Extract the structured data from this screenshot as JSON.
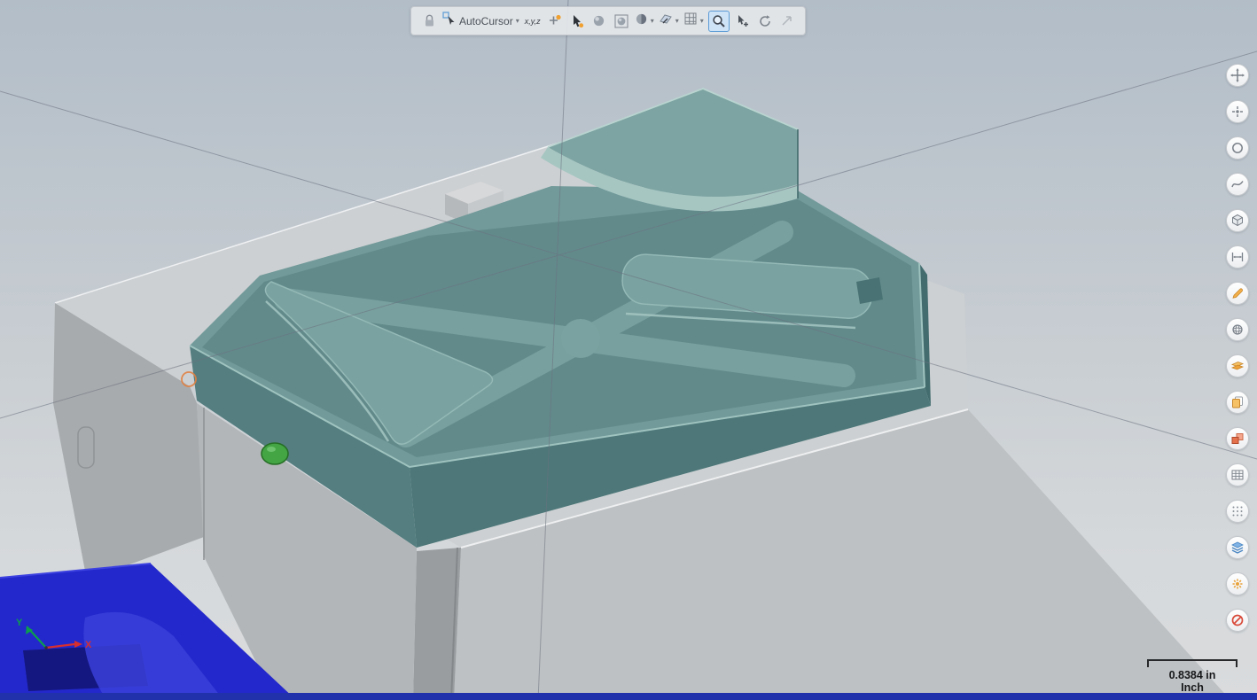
{
  "toolbar": {
    "autocursor": {
      "label": "AutoCursor"
    },
    "xyz_label": "x,y,z",
    "buttons": [
      "selection-lock",
      "autocursor",
      "gnomon-xyz",
      "cursor-settings",
      "pointer-select",
      "sphere-select",
      "box-select",
      "shaded-select",
      "plane-select",
      "grid-snap",
      "zoom-window",
      "select-add",
      "regenerate",
      "escape"
    ]
  },
  "right_toolbar": {
    "items": [
      "fit-view",
      "point-position",
      "circle-tool",
      "spline-tool",
      "view-orientation",
      "measure-distance",
      "annotate",
      "surface-tool",
      "planes",
      "copy-entities",
      "transform-entities",
      "grid-settings",
      "point-grid",
      "levels",
      "options",
      "disable-selection"
    ]
  },
  "viewport": {
    "scale_indicator": {
      "value": "0.8384 in",
      "unit": "Inch"
    },
    "axis_gizmo": {
      "y_label": "Y",
      "x_label": "X"
    }
  },
  "colors": {
    "part_top": "#729a9a",
    "part_side": "#4d7779",
    "part_skirt": "#547e80",
    "vise_top": "#cdd0d2",
    "vise_front": "#bec1c3",
    "base_blue": "#2328cc",
    "highlight_blue_bg": "#cfe3f7",
    "highlight_blue_border": "#5b9bd5",
    "statusbar_blue": "#2130ab",
    "axis_y_green": "#0b9e4d",
    "axis_x_red": "#d62f2f"
  }
}
